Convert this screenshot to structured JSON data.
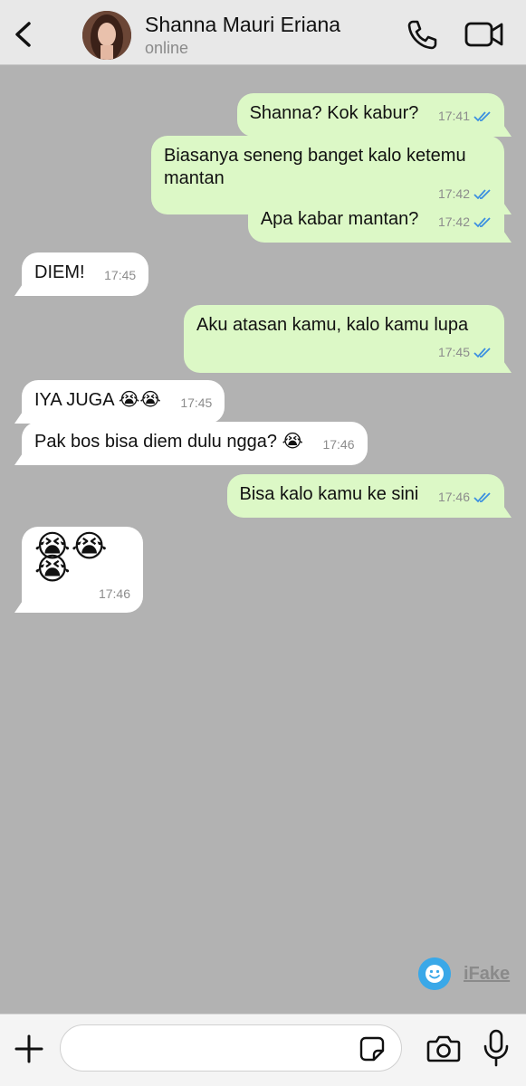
{
  "header": {
    "contact_name": "Shanna Mauri Eriana",
    "status": "online",
    "icons": [
      "back-icon",
      "avatar",
      "phone-icon",
      "video-icon"
    ]
  },
  "colors": {
    "outgoing_bubble": "#dcf8c6",
    "incoming_bubble": "#ffffff",
    "chat_background": "#b2b2b2",
    "read_ticks": "#3b8fe0"
  },
  "messages": [
    {
      "dir": "out",
      "text": "Shanna? Kok kabur?",
      "time": "17:41",
      "read": true
    },
    {
      "dir": "out",
      "text": "Biasanya seneng banget kalo ketemu mantan",
      "time": "17:42",
      "read": true
    },
    {
      "dir": "out",
      "text": "Apa kabar mantan?",
      "time": "17:42",
      "read": true
    },
    {
      "dir": "in",
      "text": "DIEM!",
      "time": "17:45"
    },
    {
      "dir": "out",
      "text": "Aku atasan kamu, kalo kamu lupa",
      "time": "17:45",
      "read": true
    },
    {
      "dir": "in",
      "text": "IYA JUGA 😭😭",
      "time": "17:45"
    },
    {
      "dir": "in",
      "text": "Pak bos bisa diem dulu ngga? 😭",
      "time": "17:46"
    },
    {
      "dir": "out",
      "text": "Bisa kalo kamu ke sini",
      "time": "17:46",
      "read": true
    },
    {
      "dir": "in",
      "text": "😭😭😭",
      "time": "17:46"
    }
  ],
  "watermark": {
    "text": "iFake"
  },
  "composer": {
    "icons": [
      "plus-icon",
      "sticker-icon",
      "camera-icon",
      "mic-icon"
    ]
  }
}
